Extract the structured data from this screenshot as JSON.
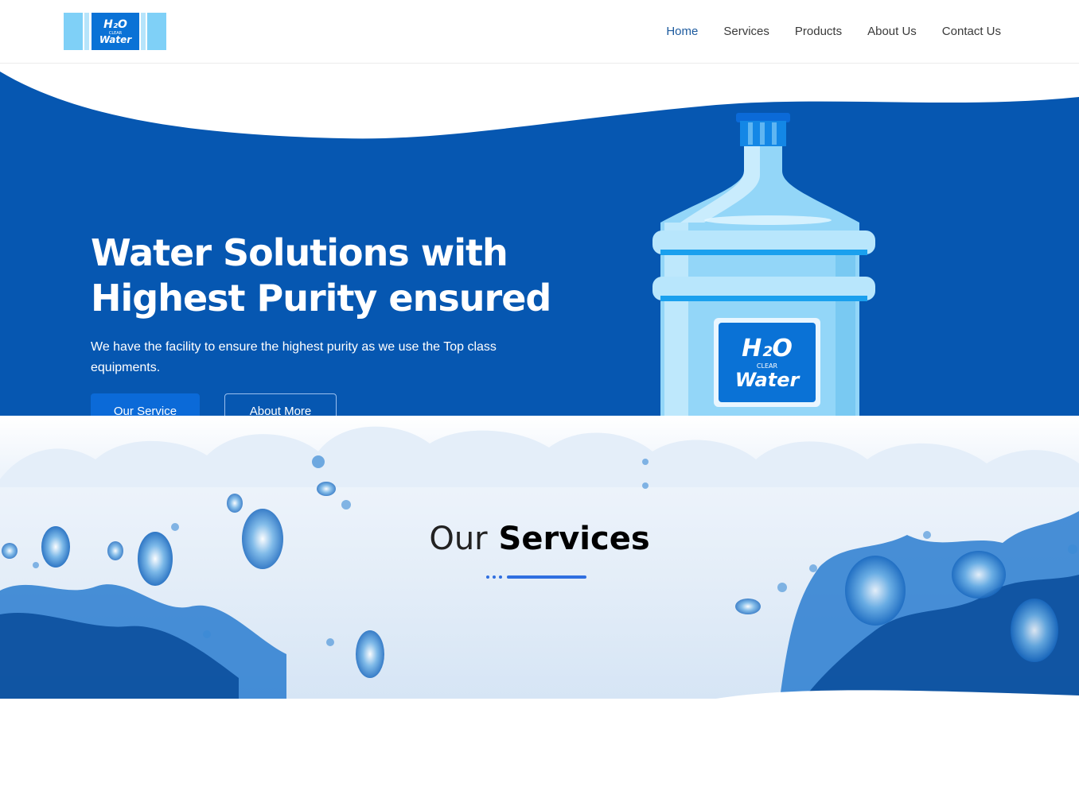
{
  "brand": {
    "logo_line1": "H₂O",
    "logo_line2": "CLEAR",
    "logo_line3": "Water"
  },
  "nav": [
    {
      "label": "Home",
      "active": true
    },
    {
      "label": "Services",
      "active": false
    },
    {
      "label": "Products",
      "active": false
    },
    {
      "label": "About Us",
      "active": false
    },
    {
      "label": "Contact Us",
      "active": false
    }
  ],
  "hero": {
    "title_line1": "Water Solutions with",
    "title_line2": "Highest Purity ensured",
    "subtitle": "We have the facility to ensure the highest purity as we use the Top class equipments.",
    "primary_button": "Our Service",
    "secondary_button": "About More",
    "bottle_label_line1": "H₂O",
    "bottle_label_line2": "CLEAR",
    "bottle_label_line3": "Water"
  },
  "services": {
    "title_light": "Our",
    "title_bold": "Services"
  },
  "colors": {
    "primary": "#0657b1",
    "accent": "#0b6ad8",
    "bottle_light": "#7fd0f7",
    "divider": "#2f6fe0"
  }
}
